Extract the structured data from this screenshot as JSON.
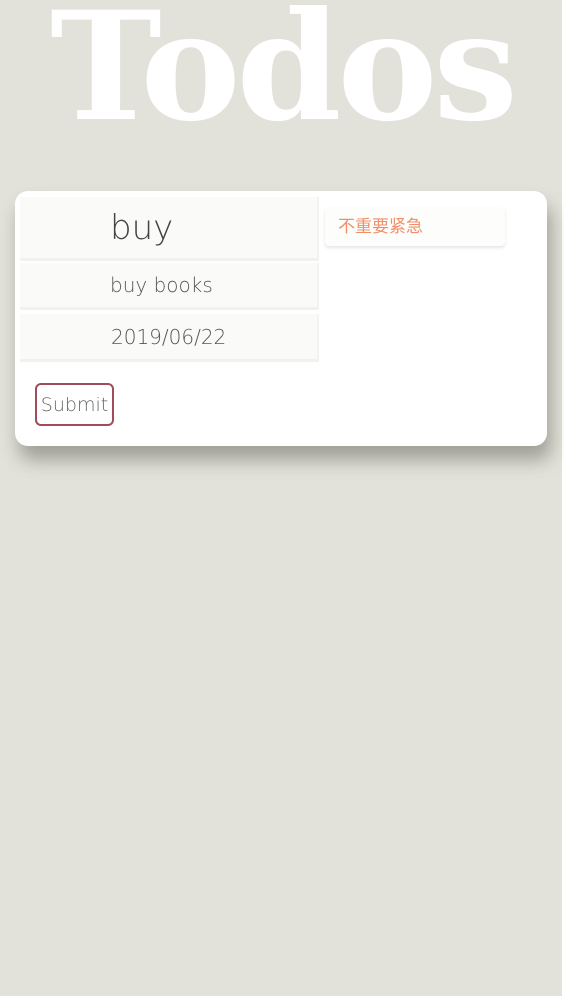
{
  "app": {
    "title": "Todos"
  },
  "form": {
    "title_value": "buy",
    "description_value": "buy books",
    "date_value": "2019/06/22",
    "priority_selected": "不重要紧急",
    "submit_label": "Submit"
  },
  "colors": {
    "background": "#e2e2da",
    "card": "#ffffff",
    "priority_text": "#f0906a",
    "submit_border": "#a24c5a"
  }
}
